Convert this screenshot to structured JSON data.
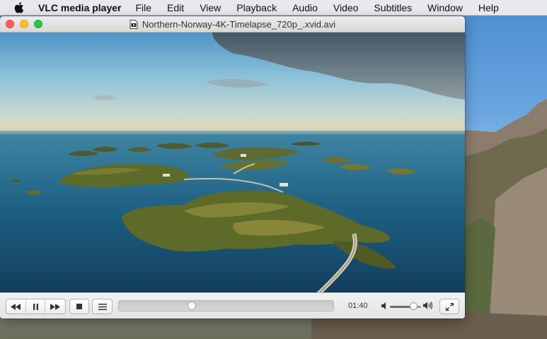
{
  "menubar": {
    "app_name": "VLC media player",
    "items": [
      "File",
      "Edit",
      "View",
      "Playback",
      "Audio",
      "Video",
      "Subtitles",
      "Window",
      "Help"
    ]
  },
  "window": {
    "title": "Northern-Norway-4K-Timelapse_720p_.xvid.avi"
  },
  "player": {
    "elapsed_time": "01:40",
    "seek_position_fraction": 0.34,
    "volume_fraction": 0.75,
    "state": "playing"
  },
  "icons": {
    "apple": "apple-logo-icon",
    "file": "video-file-icon",
    "rewind": "rewind-icon",
    "pause": "pause-icon",
    "fast_forward": "fast-forward-icon",
    "stop": "stop-icon",
    "playlist": "playlist-icon",
    "volume_low": "volume-low-icon",
    "volume_high": "volume-high-icon",
    "fullscreen": "fullscreen-icon"
  },
  "colors": {
    "close": "#fe5f57",
    "minimize": "#febc2e",
    "maximize": "#28c840"
  }
}
